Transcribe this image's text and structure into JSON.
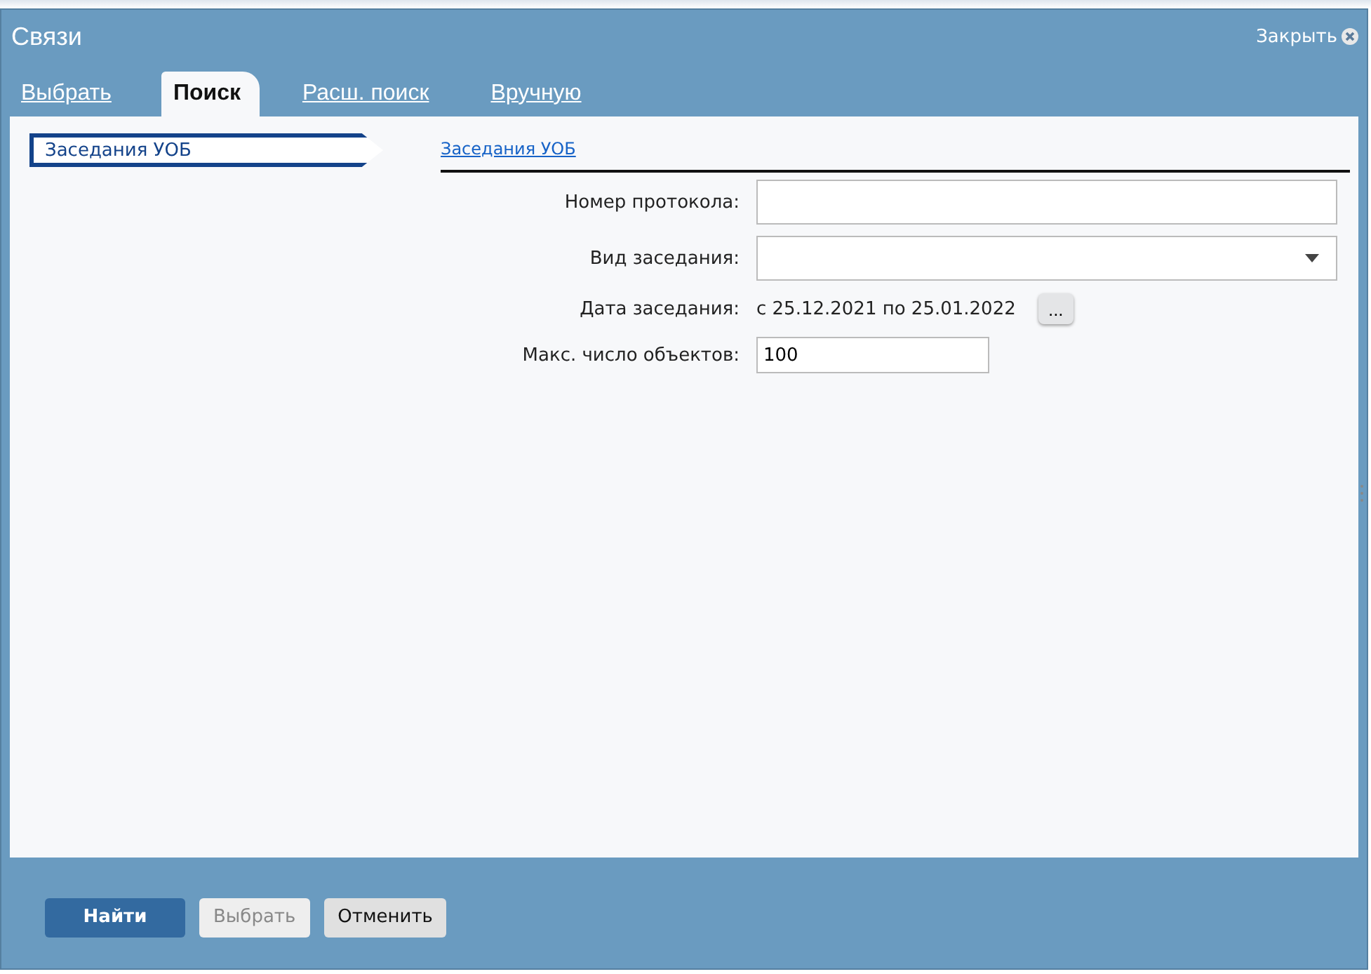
{
  "window": {
    "title": "Связи",
    "close_label": "Закрыть"
  },
  "tabs": [
    {
      "label": "Выбрать",
      "selected": false
    },
    {
      "label": "Поиск",
      "selected": true
    },
    {
      "label": "Расш. поиск",
      "selected": false
    },
    {
      "label": "Вручную",
      "selected": false
    }
  ],
  "sidebar": {
    "items": [
      {
        "label": "Заседания УОБ",
        "selected": true
      }
    ]
  },
  "form": {
    "breadcrumb": "Заседания УОБ",
    "fields": [
      {
        "kind": "text",
        "label": "Номер протокола:"
      },
      {
        "kind": "select",
        "label": "Вид заседания:"
      },
      {
        "kind": "date_range",
        "label": "Дата заседания:",
        "value": "с 25.12.2021 по 25.01.2022",
        "button": "..."
      },
      {
        "kind": "short_text",
        "label": "Макс. число объектов:",
        "value": "100"
      }
    ]
  },
  "buttons": [
    {
      "label": "Найти",
      "kind": "primary",
      "disabled": false
    },
    {
      "label": "Выбрать",
      "kind": "normal",
      "disabled": true
    },
    {
      "label": "Отменить",
      "kind": "normal",
      "disabled": false
    }
  ]
}
